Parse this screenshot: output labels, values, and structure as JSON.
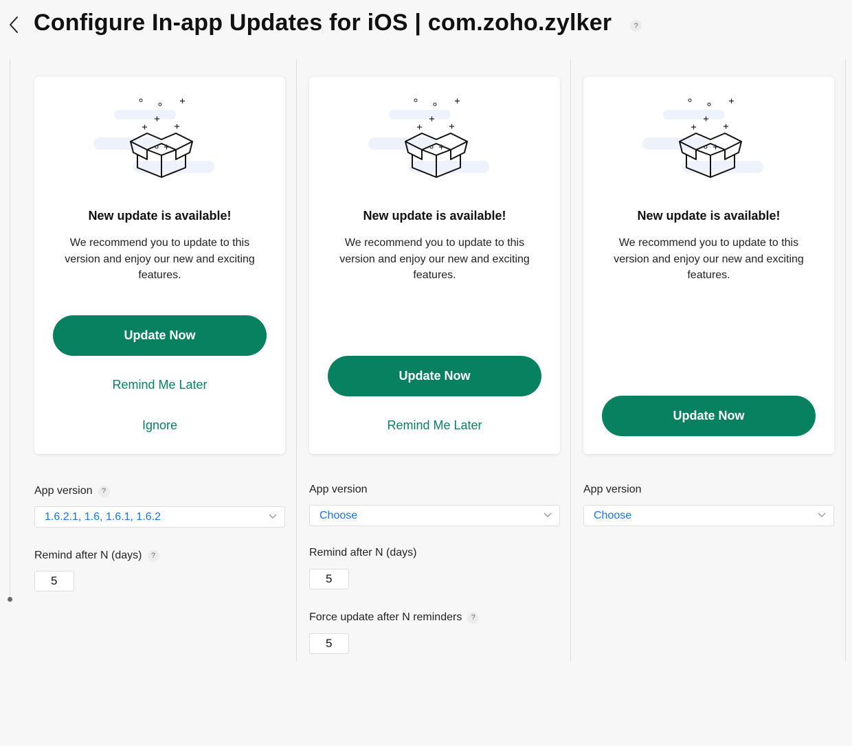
{
  "header": {
    "title": "Configure In-app Updates for iOS | com.zoho.zylker",
    "help_icon": "question-icon",
    "help_text": "?"
  },
  "colors": {
    "accent": "#078160",
    "link": "#1a73e8",
    "background": "#f7f7f8"
  },
  "columns": [
    {
      "card": {
        "title": "New update is available!",
        "description": "We recommend you to update to this version and enjoy our new and exciting features.",
        "update_label": "Update Now",
        "remind_label": "Remind Me Later",
        "ignore_label": "Ignore"
      },
      "app_version": {
        "label": "App version",
        "value": "1.6.2.1, 1.6, 1.6.1, 1.6.2"
      },
      "remind_days": {
        "label": "Remind after N (days)",
        "value": "5"
      }
    },
    {
      "card": {
        "title": "New update is available!",
        "description": "We recommend you to update to this version and enjoy our new and exciting features.",
        "update_label": "Update Now",
        "remind_label": "Remind Me Later"
      },
      "app_version": {
        "label": "App version",
        "value": "Choose"
      },
      "remind_days": {
        "label": "Remind after N (days)",
        "value": "5"
      },
      "force_update": {
        "label": "Force update after N reminders",
        "value": "5"
      }
    },
    {
      "card": {
        "title": "New update is available!",
        "description": "We recommend you to update to this version and enjoy our new and exciting features.",
        "update_label": "Update Now"
      },
      "app_version": {
        "label": "App version",
        "value": "Choose"
      }
    }
  ]
}
